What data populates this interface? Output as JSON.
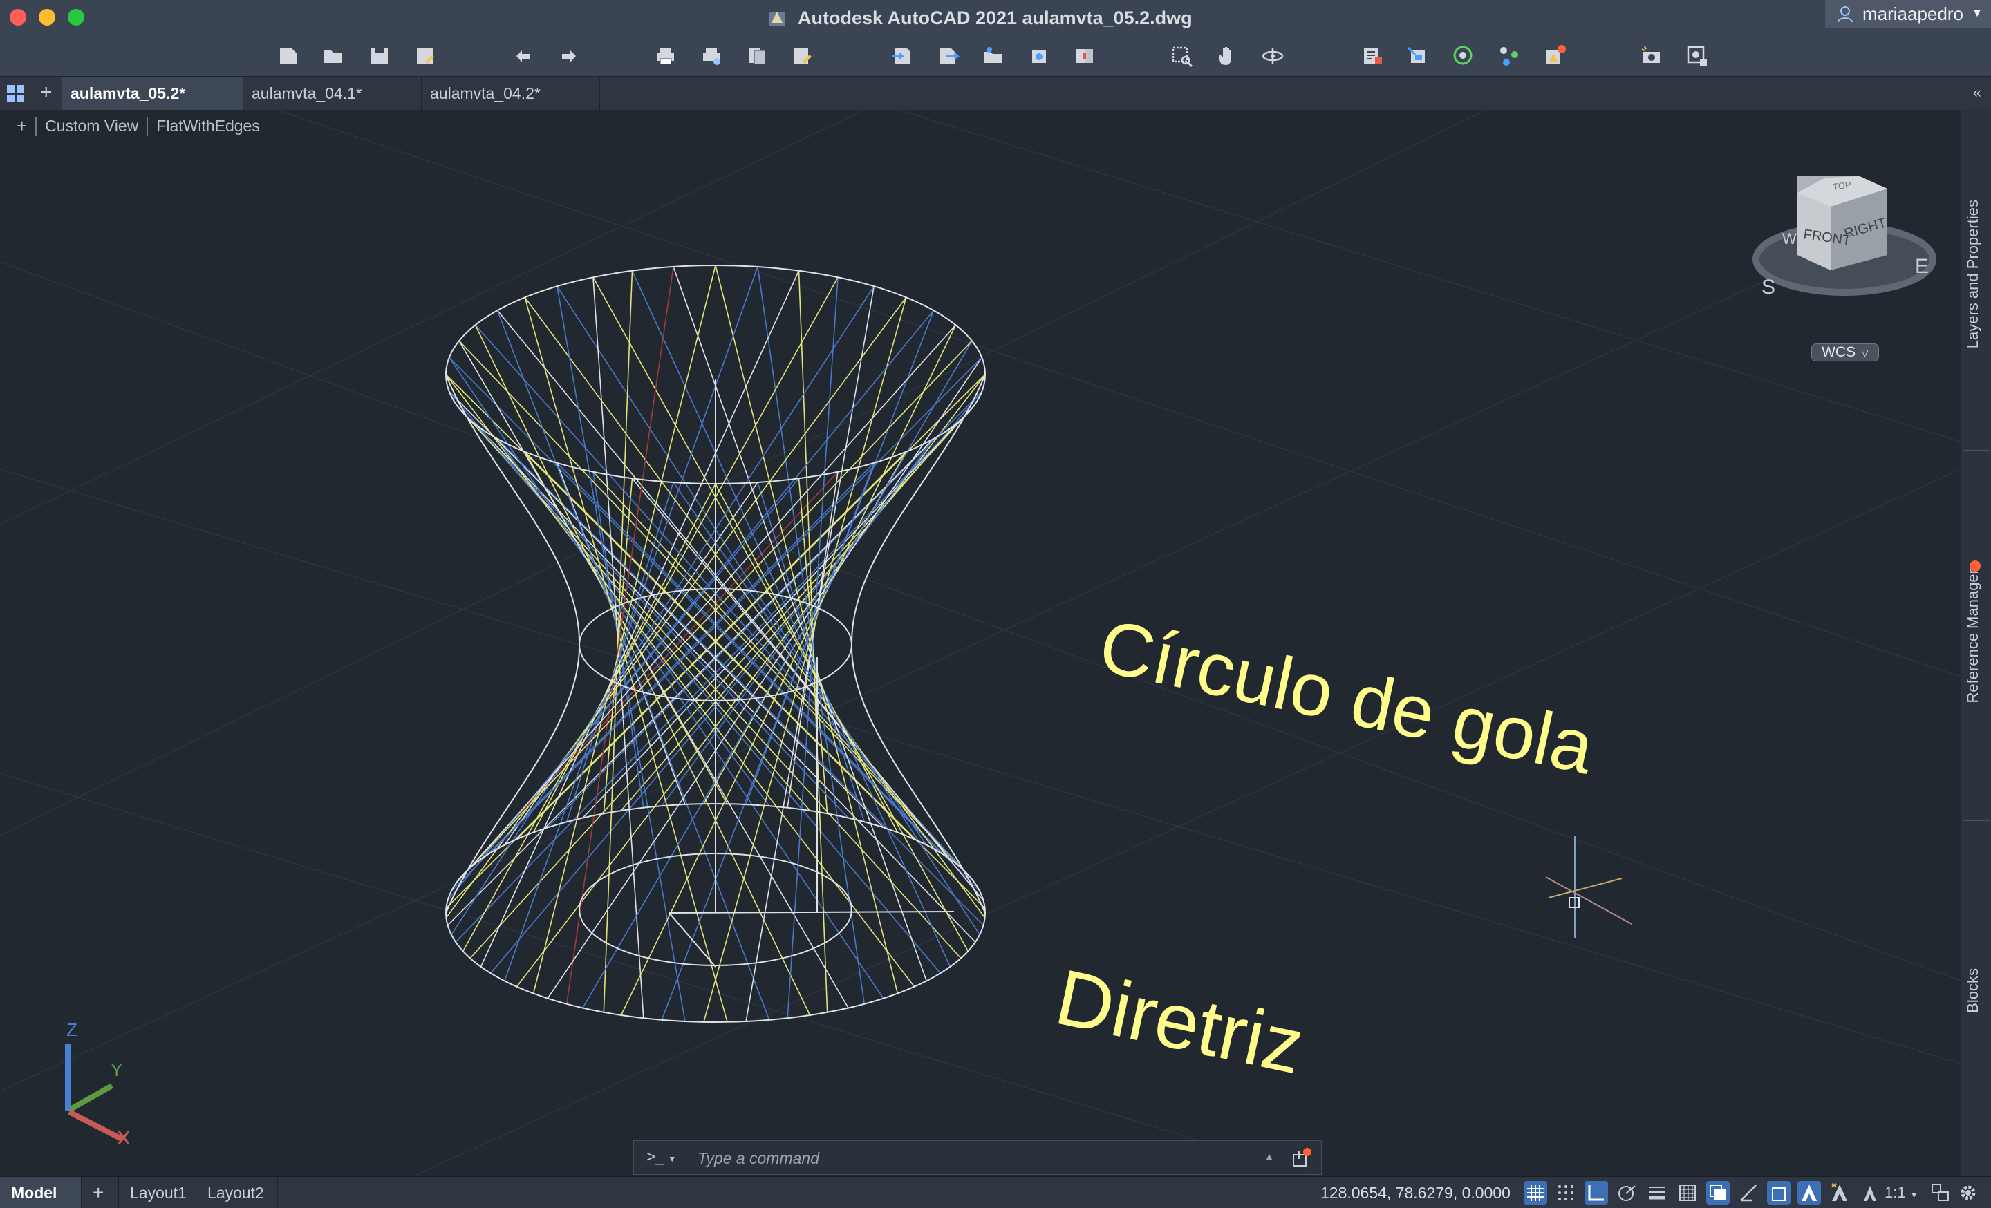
{
  "window": {
    "title": "Autodesk AutoCAD 2021    aulamvta_05.2.dwg",
    "user": "mariaapedro"
  },
  "tabs": [
    {
      "label": "aulamvta_05.2*",
      "active": true
    },
    {
      "label": "aulamvta_04.1*",
      "active": false
    },
    {
      "label": "aulamvta_04.2*",
      "active": false
    }
  ],
  "viewport": {
    "plus": "+",
    "view_name": "Custom View",
    "visual_style": "FlatWithEdges",
    "text_annotations": [
      "Círculo de gola",
      "Diretriz"
    ],
    "annotation_color": "#fffc8c"
  },
  "viewcube": {
    "top": "TOP",
    "front": "FRONT",
    "right": "RIGHT",
    "compass_s": "S",
    "compass_e": "E",
    "compass_w": "W",
    "wcs": "WCS"
  },
  "ucs": {
    "z": "Z",
    "y": "Y"
  },
  "palettes": [
    "Layers and Properties",
    "Reference Manager",
    "Blocks"
  ],
  "command": {
    "prompt": ">_",
    "placeholder": "Type a command"
  },
  "layouts": [
    "Model",
    "+",
    "Layout1",
    "Layout2"
  ],
  "status": {
    "coordinates": "128.0654, 78.6279, 0.0000",
    "scale": "1:1"
  }
}
